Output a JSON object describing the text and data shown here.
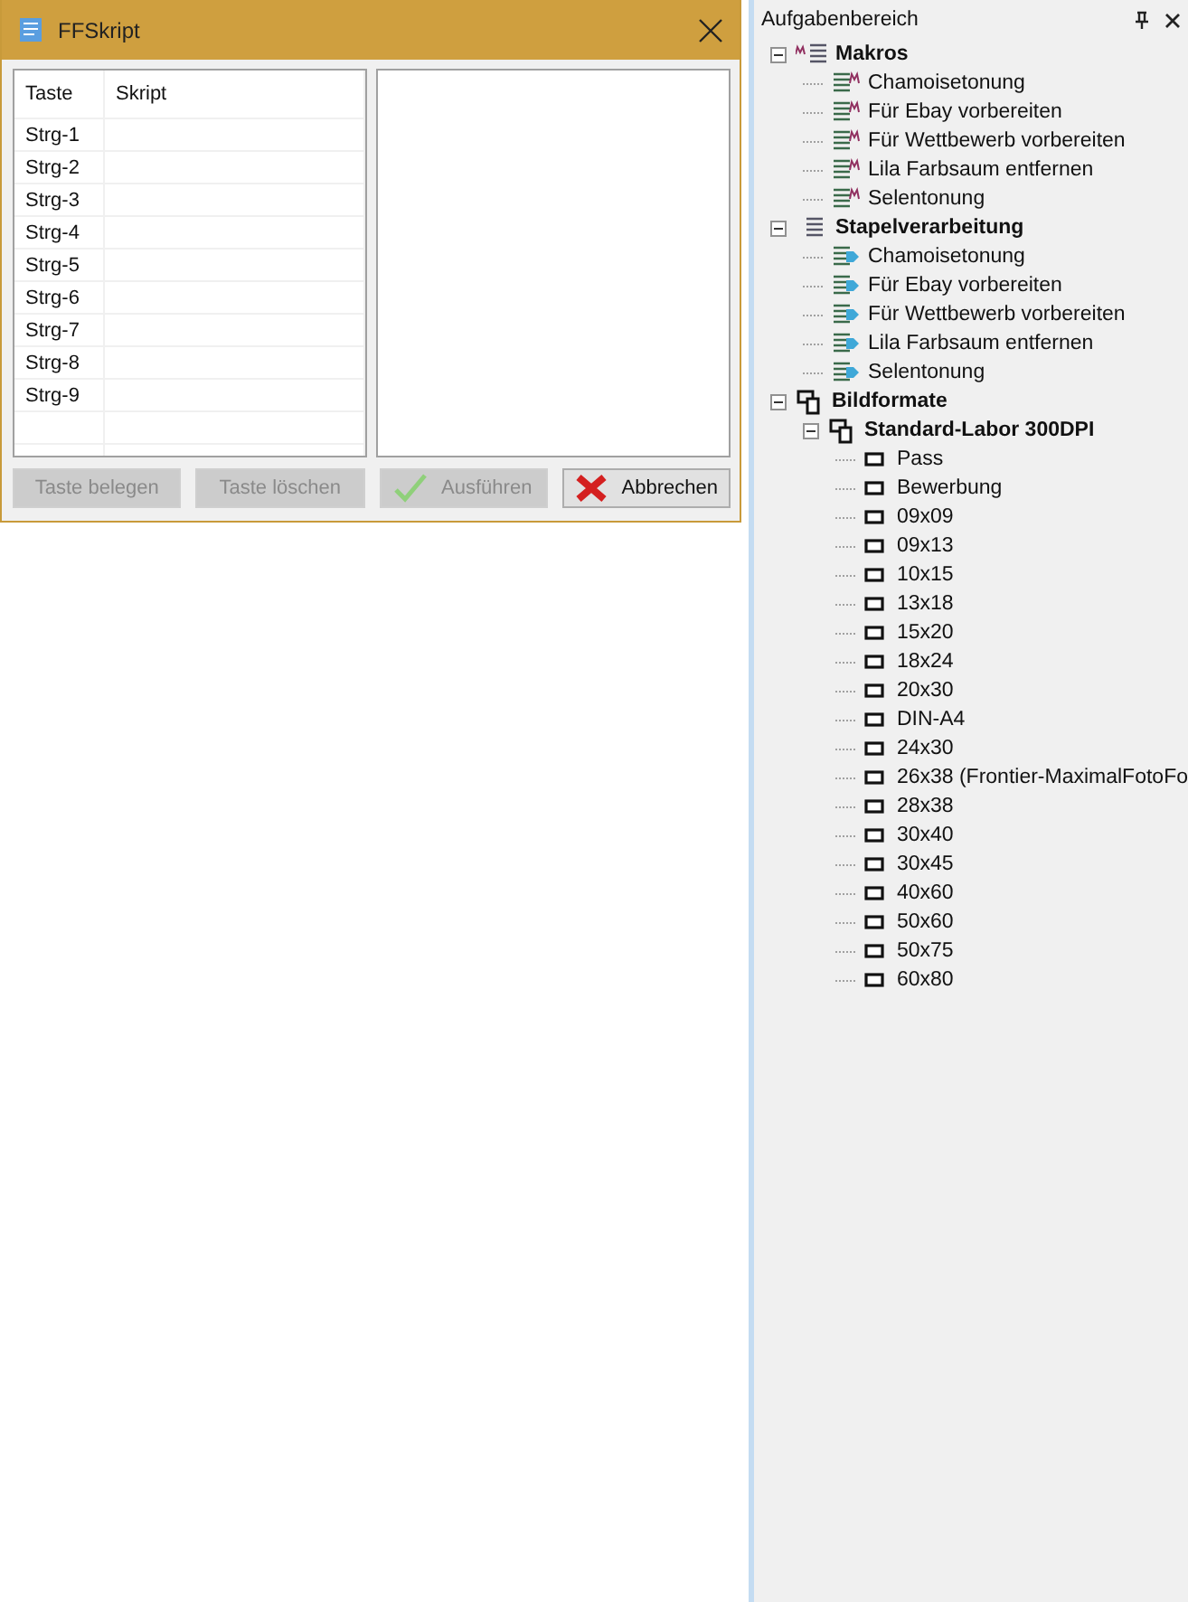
{
  "dialog": {
    "title": "FFSkript",
    "table": {
      "columns": [
        "Taste",
        "Skript"
      ],
      "rows": [
        "Strg-1",
        "Strg-2",
        "Strg-3",
        "Strg-4",
        "Strg-5",
        "Strg-6",
        "Strg-7",
        "Strg-8",
        "Strg-9"
      ]
    },
    "buttons": [
      {
        "label": "Taste belegen",
        "disabled": true,
        "kind": "plain"
      },
      {
        "label": "Taste löschen",
        "disabled": true,
        "kind": "plain"
      },
      {
        "label": "Ausführen",
        "disabled": true,
        "kind": "confirm"
      },
      {
        "label": "Abbrechen",
        "disabled": false,
        "kind": "cancel"
      }
    ]
  },
  "panel": {
    "title": "Aufgabenbereich",
    "tree": [
      {
        "label": "Makros",
        "kind": "macro-group",
        "expanded": true,
        "children": [
          {
            "label": "Chamoisetonung",
            "kind": "macro"
          },
          {
            "label": "Für Ebay vorbereiten",
            "kind": "macro"
          },
          {
            "label": "Für Wettbewerb vorbereiten",
            "kind": "macro"
          },
          {
            "label": "Lila Farbsaum entfernen",
            "kind": "macro"
          },
          {
            "label": "Selentonung",
            "kind": "macro"
          }
        ]
      },
      {
        "label": "Stapelverarbeitung",
        "kind": "batch-group",
        "expanded": true,
        "children": [
          {
            "label": "Chamoisetonung",
            "kind": "batch"
          },
          {
            "label": "Für Ebay vorbereiten",
            "kind": "batch"
          },
          {
            "label": "Für Wettbewerb vorbereiten",
            "kind": "batch"
          },
          {
            "label": "Lila Farbsaum entfernen",
            "kind": "batch"
          },
          {
            "label": "Selentonung",
            "kind": "batch"
          }
        ]
      },
      {
        "label": "Bildformate",
        "kind": "format-group",
        "expanded": true,
        "children": [
          {
            "label": "Standard-Labor 300DPI",
            "kind": "format-group",
            "expanded": true,
            "children": [
              {
                "label": "Pass",
                "kind": "format"
              },
              {
                "label": "Bewerbung",
                "kind": "format"
              },
              {
                "label": "09x09",
                "kind": "format"
              },
              {
                "label": "09x13",
                "kind": "format"
              },
              {
                "label": "10x15",
                "kind": "format"
              },
              {
                "label": "13x18",
                "kind": "format"
              },
              {
                "label": "15x20",
                "kind": "format"
              },
              {
                "label": "18x24",
                "kind": "format"
              },
              {
                "label": "20x30",
                "kind": "format"
              },
              {
                "label": "DIN-A4",
                "kind": "format"
              },
              {
                "label": "24x30",
                "kind": "format"
              },
              {
                "label": "26x38 (Frontier-MaximalFotoFo",
                "kind": "format"
              },
              {
                "label": "28x38",
                "kind": "format"
              },
              {
                "label": "30x40",
                "kind": "format"
              },
              {
                "label": "30x45",
                "kind": "format"
              },
              {
                "label": "40x60",
                "kind": "format"
              },
              {
                "label": "50x60",
                "kind": "format"
              },
              {
                "label": "50x75",
                "kind": "format"
              },
              {
                "label": "60x80",
                "kind": "format"
              }
            ]
          }
        ]
      }
    ]
  }
}
